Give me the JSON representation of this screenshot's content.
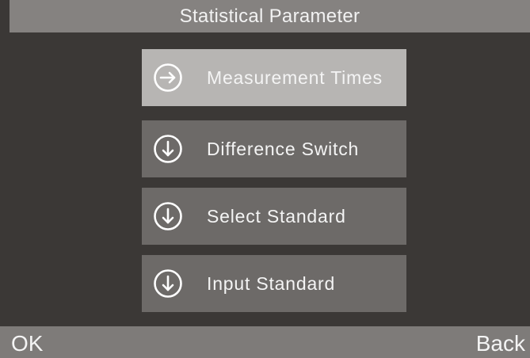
{
  "header": {
    "title": "Statistical Parameter"
  },
  "menu": {
    "items": [
      {
        "label": "Measurement Times",
        "icon": "arrow-right-circle-icon",
        "selected": true
      },
      {
        "label": "Difference Switch",
        "icon": "arrow-down-circle-icon",
        "selected": false
      },
      {
        "label": "Select Standard",
        "icon": "arrow-down-circle-icon",
        "selected": false
      },
      {
        "label": "Input Standard",
        "icon": "arrow-down-circle-icon",
        "selected": false
      }
    ]
  },
  "footer": {
    "ok_label": "OK",
    "back_label": "Back"
  },
  "colors": {
    "background": "#3b3836",
    "title_bar": "#858280",
    "item": "#6d6a68",
    "item_selected": "#b7b5b3",
    "bottom_bar": "#7e7b79",
    "text": "#f4f4f4"
  }
}
